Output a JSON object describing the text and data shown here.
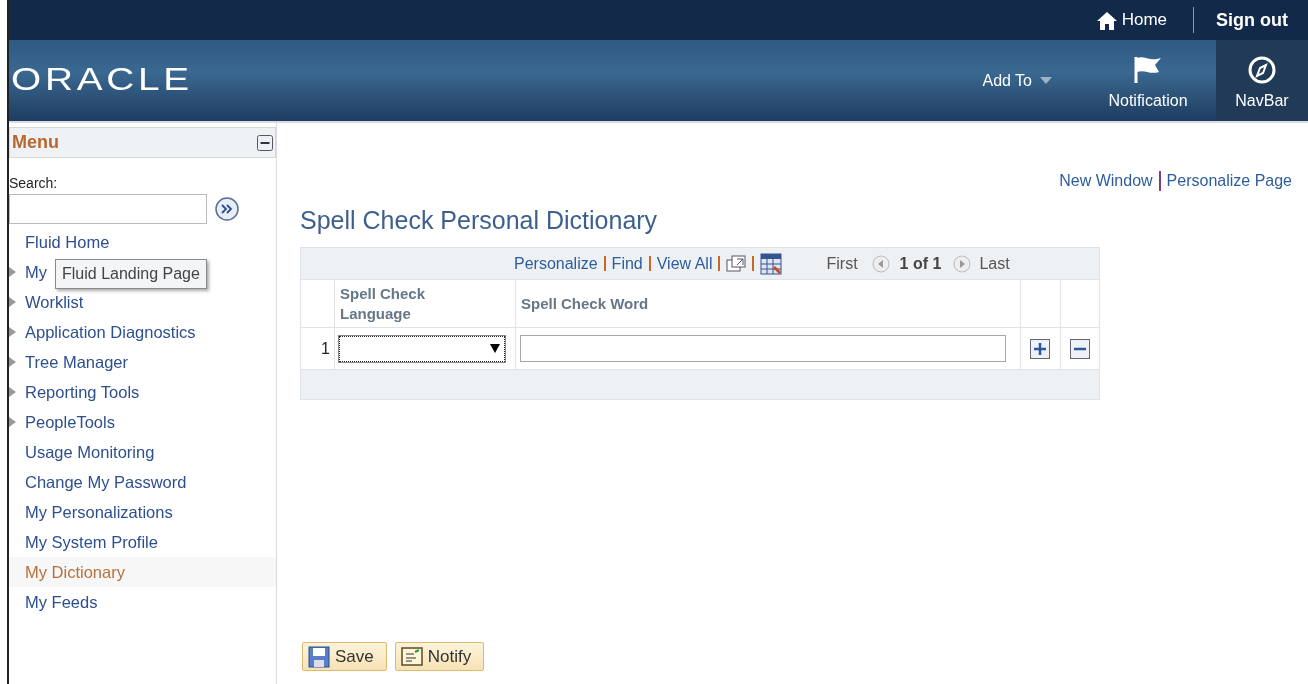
{
  "top_bar": {
    "home": "Home",
    "sign_out": "Sign out"
  },
  "header": {
    "logo": "ORACLE",
    "add_to": "Add To",
    "notification": "Notification",
    "navbar": "NavBar"
  },
  "menu": {
    "title": "Menu",
    "search_label": "Search:",
    "tooltip": "Fluid Landing Page",
    "items": [
      {
        "label": "Fluid Home",
        "expandable": false,
        "selected": false
      },
      {
        "label": "My",
        "expandable": true,
        "selected": false
      },
      {
        "label": "Worklist",
        "expandable": true,
        "selected": false
      },
      {
        "label": "Application Diagnostics",
        "expandable": true,
        "selected": false
      },
      {
        "label": "Tree Manager",
        "expandable": true,
        "selected": false
      },
      {
        "label": "Reporting Tools",
        "expandable": true,
        "selected": false
      },
      {
        "label": "PeopleTools",
        "expandable": true,
        "selected": false
      },
      {
        "label": "Usage Monitoring",
        "expandable": false,
        "selected": false
      },
      {
        "label": "Change My Password",
        "expandable": false,
        "selected": false
      },
      {
        "label": "My Personalizations",
        "expandable": false,
        "selected": false
      },
      {
        "label": "My System Profile",
        "expandable": false,
        "selected": false
      },
      {
        "label": "My Dictionary",
        "expandable": false,
        "selected": true
      },
      {
        "label": "My Feeds",
        "expandable": false,
        "selected": false
      }
    ]
  },
  "page_links": [
    "New Window",
    "Personalize Page"
  ],
  "page_title": "Spell Check Personal Dictionary",
  "grid": {
    "toolbar_links": [
      "Personalize",
      "Find",
      "View All"
    ],
    "first": "First",
    "pager": "1 of 1",
    "last": "Last",
    "columns": [
      "Spell Check Language",
      "Spell Check Word"
    ],
    "rows": [
      {
        "number": "1"
      }
    ]
  },
  "buttons": [
    {
      "kind": "save",
      "label": "Save"
    },
    {
      "kind": "notify",
      "label": "Notify"
    }
  ]
}
